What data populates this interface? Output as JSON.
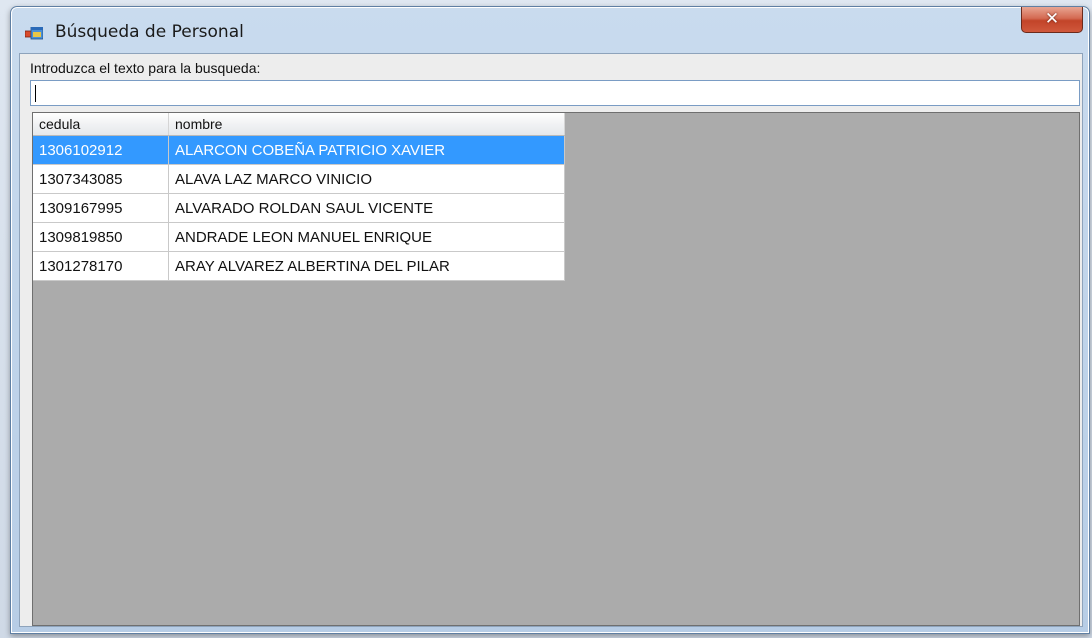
{
  "window": {
    "title": "Búsqueda de Personal",
    "close_glyph": "✕"
  },
  "search": {
    "label": "Introduzca el texto para la busqueda:",
    "value": ""
  },
  "table": {
    "columns": [
      "cedula",
      "nombre"
    ],
    "rows": [
      {
        "cedula": "1306102912",
        "nombre": "ALARCON COBEÑA PATRICIO XAVIER",
        "selected": true
      },
      {
        "cedula": "1307343085",
        "nombre": "ALAVA LAZ MARCO VINICIO",
        "selected": false
      },
      {
        "cedula": "1309167995",
        "nombre": "ALVARADO ROLDAN SAUL VICENTE",
        "selected": false
      },
      {
        "cedula": "1309819850",
        "nombre": "ANDRADE LEON MANUEL ENRIQUE",
        "selected": false
      },
      {
        "cedula": "1301278170",
        "nombre": "ARAY ALVAREZ ALBERTINA DEL PILAR",
        "selected": false
      }
    ]
  },
  "colors": {
    "selection": "#3399ff",
    "grid_background": "#ababab",
    "close_button": "#c24429"
  },
  "icons": {
    "app": "window-app-icon",
    "close": "close-icon"
  }
}
